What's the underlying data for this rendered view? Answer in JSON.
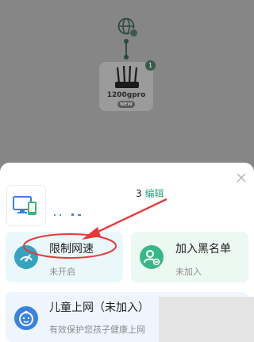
{
  "topology": {
    "router": {
      "name": "1200gpro",
      "badge_count": "1",
      "new_label": "NEW"
    }
  },
  "sheet": {
    "title_partial": "3",
    "edit_label": "编辑",
    "cards": {
      "speed_limit": {
        "title": "限制网速",
        "status": "未开启"
      },
      "blacklist": {
        "title": "加入黑名单",
        "status": "未加入"
      },
      "child_net": {
        "title": "儿童上网（未加入）",
        "status": "有效保护您孩子健康上网"
      }
    }
  },
  "colors": {
    "accent_green": "#2aa77b",
    "annotation_red": "#e63b3b",
    "speed_icon": "#33a3c1",
    "blacklist_icon": "#37b889",
    "child_icon": "#3a82df"
  },
  "icons": {
    "network": "globe-icon",
    "router": "router-icon",
    "close": "close-icon",
    "device": "device-icon",
    "speed_limit": "speedometer-icon",
    "blacklist": "user-block-icon",
    "child": "child-face-icon"
  }
}
